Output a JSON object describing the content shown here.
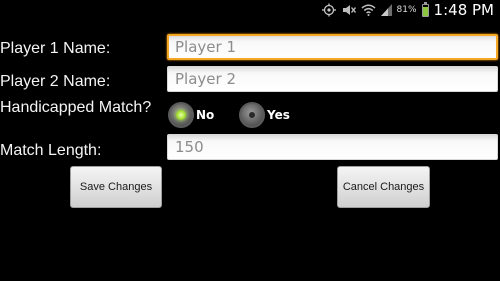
{
  "status_bar": {
    "battery_percent": "81%",
    "battery_level": 0.81,
    "time": "1:48 PM",
    "icons": [
      "gps-icon",
      "mute-icon",
      "wifi-icon",
      "signal-icon",
      "battery-icon"
    ],
    "battery_color": "#8cc63f"
  },
  "form": {
    "player1": {
      "label": "Player 1 Name:",
      "placeholder": "Player 1",
      "value": ""
    },
    "player2": {
      "label": "Player 2 Name:",
      "placeholder": "Player 2",
      "value": ""
    },
    "handicap": {
      "label": "Handicapped Match?",
      "options": [
        {
          "label": "No",
          "selected": true
        },
        {
          "label": "Yes",
          "selected": false
        }
      ]
    },
    "match_length": {
      "label": "Match Length:",
      "value": "150"
    }
  },
  "buttons": {
    "save_label": "Save Changes",
    "cancel_label": "Cancel Changes"
  },
  "colors": {
    "focus_border": "#f5a623",
    "radio_selected": "#a6e033",
    "background": "#000000"
  }
}
